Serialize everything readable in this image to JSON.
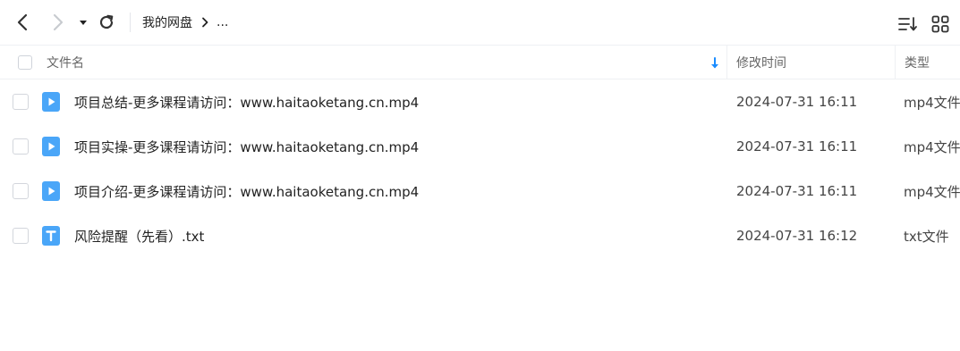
{
  "toolbar": {
    "breadcrumb_root": "我的网盘",
    "breadcrumb_more": "..."
  },
  "columns": {
    "name": "文件名",
    "modified": "修改时间",
    "type": "类型"
  },
  "files": [
    {
      "name": "项目总结-更多课程请访问：www.haitaoketang.cn.mp4",
      "modified": "2024-07-31 16:11",
      "type": "mp4文件",
      "icon": "video-file-icon"
    },
    {
      "name": "项目实操-更多课程请访问：www.haitaoketang.cn.mp4",
      "modified": "2024-07-31 16:11",
      "type": "mp4文件",
      "icon": "video-file-icon"
    },
    {
      "name": "项目介绍-更多课程请访问：www.haitaoketang.cn.mp4",
      "modified": "2024-07-31 16:11",
      "type": "mp4文件",
      "icon": "video-file-icon"
    },
    {
      "name": "风险提醒（先看）.txt",
      "modified": "2024-07-31 16:12",
      "type": "txt文件",
      "icon": "text-file-icon"
    }
  ],
  "colors": {
    "accent": "#1a8cff",
    "file_icon": "#4aa6f8"
  }
}
